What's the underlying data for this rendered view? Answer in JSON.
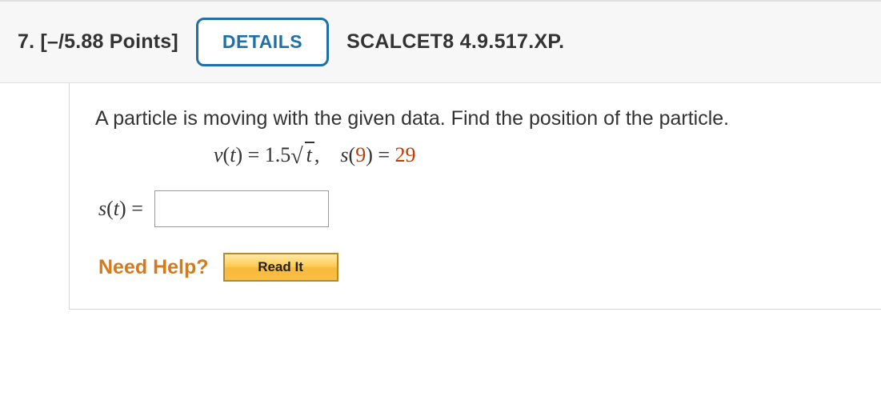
{
  "header": {
    "number": "7.",
    "points": "[–/5.88 Points]",
    "details_label": "DETAILS",
    "source": "SCALCET8 4.9.517.XP."
  },
  "question": {
    "prompt": "A particle is moving with the given data. Find the position of the particle.",
    "eq_v_left": "v",
    "eq_v_arg": "t",
    "eq_v_eq": " = 1.5",
    "eq_v_radicand": "t",
    "eq_comma": ",",
    "eq_s_left": "s",
    "eq_s_arg": "9",
    "eq_s_eq": " = ",
    "eq_s_val": "29",
    "answer_label_fn": "s",
    "answer_label_arg": "t",
    "answer_label_eq": " ="
  },
  "help": {
    "label": "Need Help?",
    "readit": "Read It"
  }
}
